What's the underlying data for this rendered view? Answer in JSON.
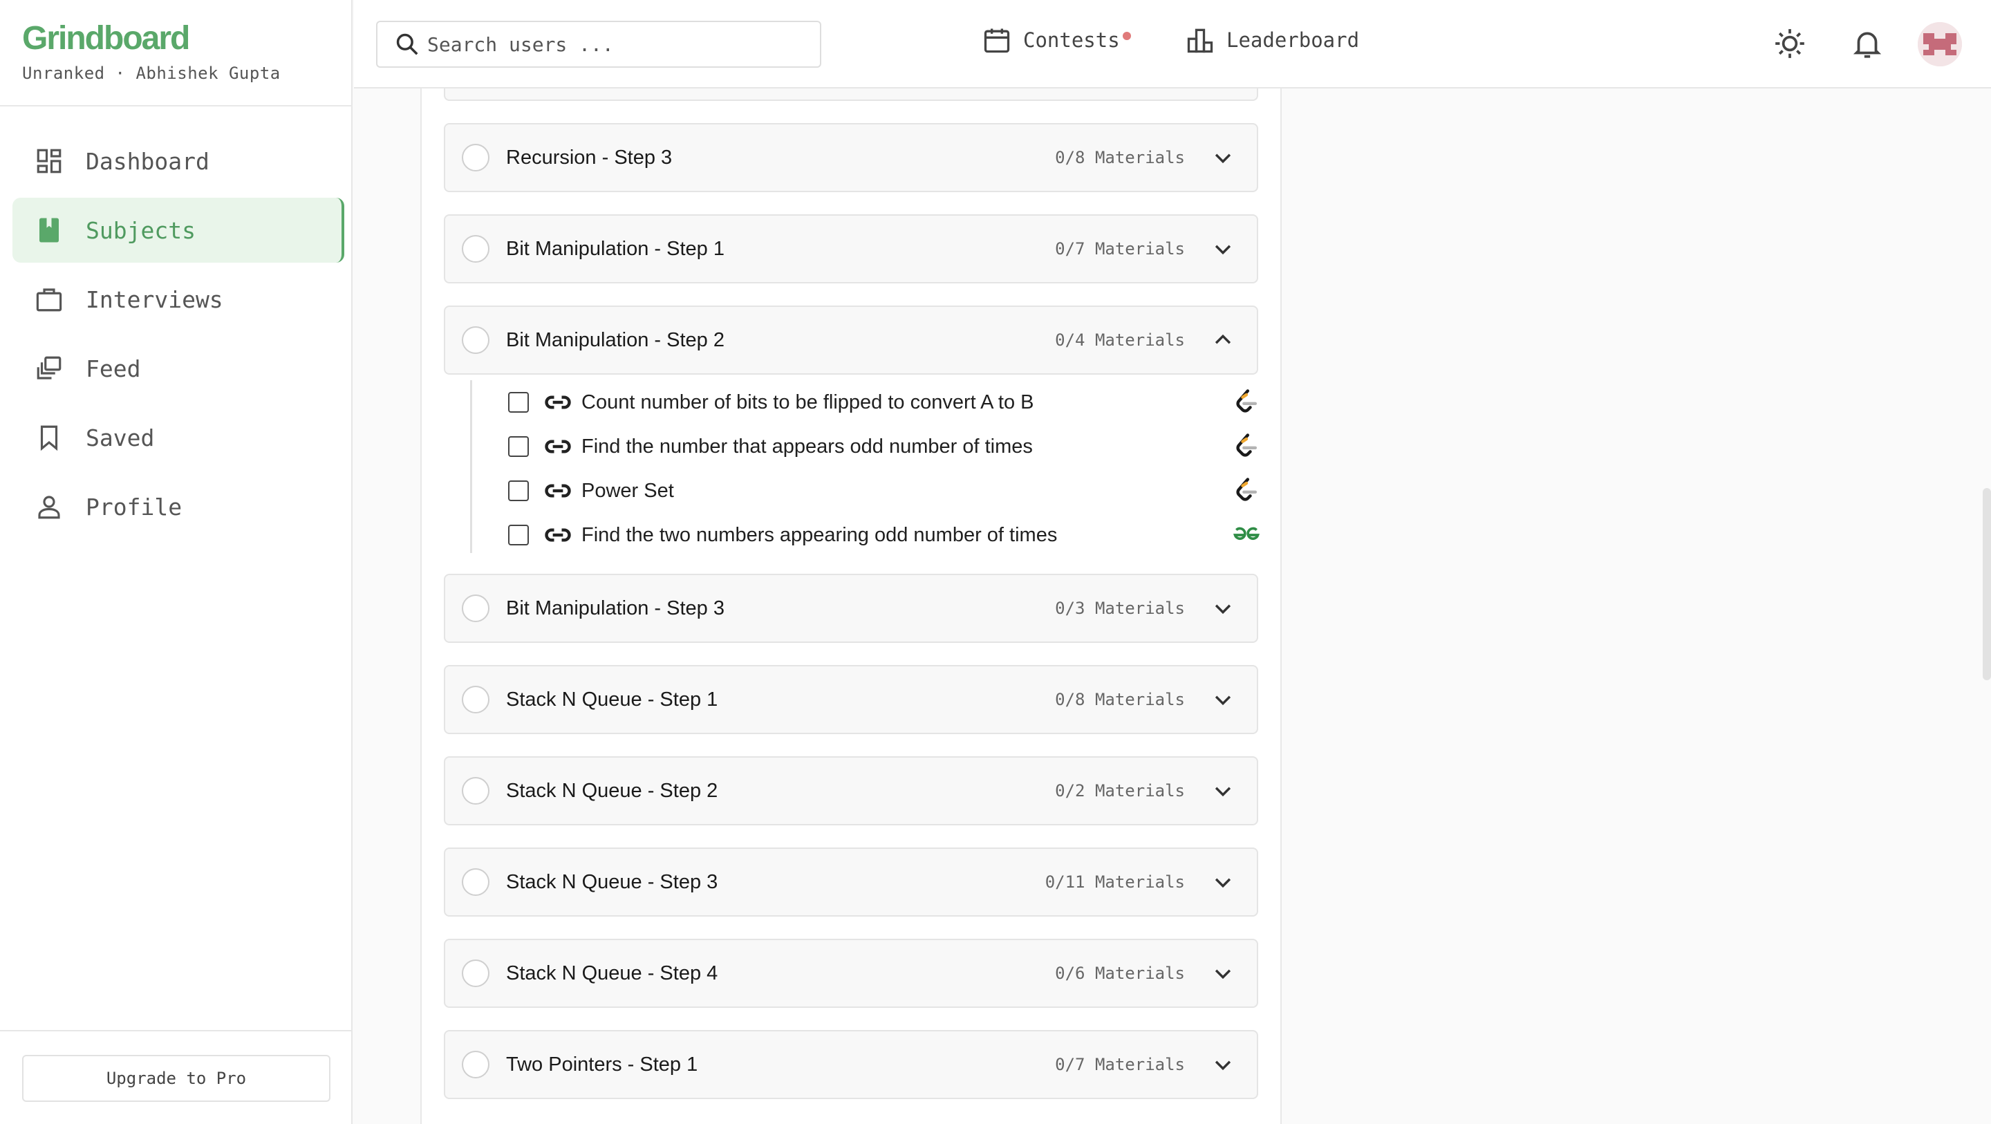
{
  "app": {
    "name": "Grindboard",
    "rank_line": "Unranked · Abhishek Gupta",
    "brand_color": "#5aa86a"
  },
  "nav": {
    "items": [
      {
        "label": "Dashboard",
        "icon": "dashboard-icon"
      },
      {
        "label": "Subjects",
        "icon": "book-icon",
        "active": true
      },
      {
        "label": "Interviews",
        "icon": "briefcase-icon"
      },
      {
        "label": "Feed",
        "icon": "feed-icon"
      },
      {
        "label": "Saved",
        "icon": "bookmark-icon"
      },
      {
        "label": "Profile",
        "icon": "person-icon"
      }
    ]
  },
  "footer": {
    "upgrade_label": "Upgrade to Pro"
  },
  "topbar": {
    "search_placeholder": "Search users ...",
    "contests_label": "Contests",
    "leaderboard_label": "Leaderboard"
  },
  "sections": [
    {
      "title": "Recursion - Step 3",
      "count": "0/8 Materials",
      "expanded": false
    },
    {
      "title": "Bit Manipulation - Step 1",
      "count": "0/7 Materials",
      "expanded": false
    },
    {
      "title": "Bit Manipulation - Step 2",
      "count": "0/4 Materials",
      "expanded": true
    },
    {
      "title": "Bit Manipulation - Step 3",
      "count": "0/3 Materials",
      "expanded": false
    },
    {
      "title": "Stack N Queue - Step 1",
      "count": "0/8 Materials",
      "expanded": false
    },
    {
      "title": "Stack N Queue - Step 2",
      "count": "0/2 Materials",
      "expanded": false
    },
    {
      "title": "Stack N Queue - Step 3",
      "count": "0/11 Materials",
      "expanded": false
    },
    {
      "title": "Stack N Queue - Step 4",
      "count": "0/6 Materials",
      "expanded": false
    },
    {
      "title": "Two Pointers - Step 1",
      "count": "0/7 Materials",
      "expanded": false
    }
  ],
  "materials": [
    {
      "title": "Count number of bits to be flipped to convert A to B",
      "source": "leetcode-icon"
    },
    {
      "title": "Find the number that appears odd number of times",
      "source": "leetcode-icon"
    },
    {
      "title": "Power Set",
      "source": "leetcode-icon"
    },
    {
      "title": "Find the two numbers appearing odd number of times",
      "source": "geeksforgeeks-icon"
    }
  ]
}
